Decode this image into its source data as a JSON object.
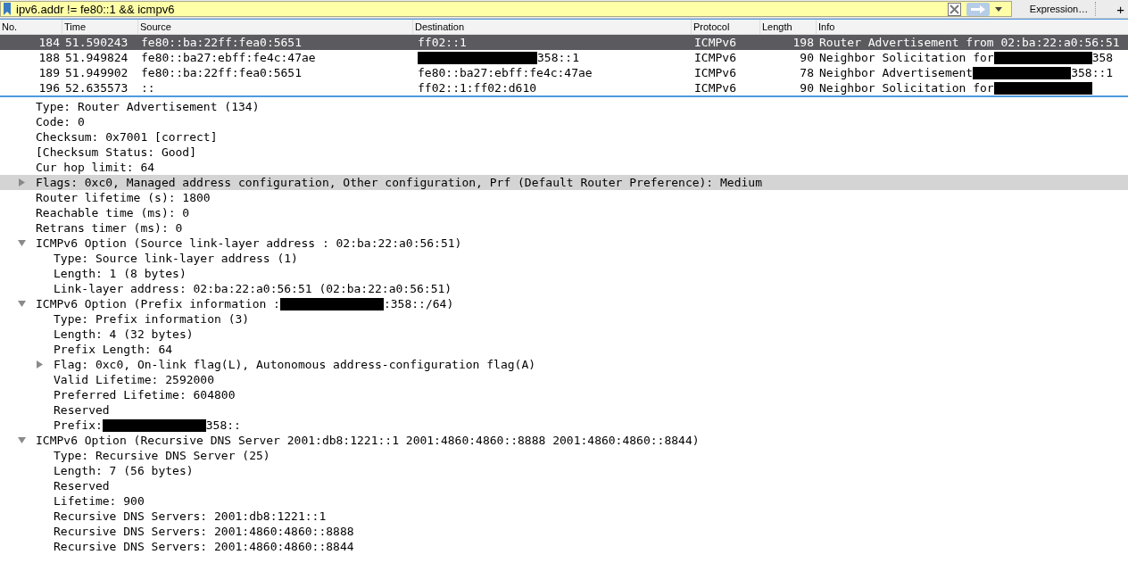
{
  "filter_bar": {
    "value": "ipv6.addr != fe80::1 && icmpv6",
    "expression_button": "Expression…",
    "add_button": "+"
  },
  "packet_list": {
    "columns": [
      "No.",
      "Time",
      "Source",
      "Destination",
      "Protocol",
      "Length",
      "Info"
    ],
    "rows": [
      {
        "selected": true,
        "cells": [
          "184",
          "51.590243",
          "fe80::ba:22ff:fea0:5651",
          "ff02::1",
          "ICMPv6",
          "198",
          "Router Advertisement from 02:ba:22:a0:56:51"
        ]
      },
      {
        "selected": false,
        "cells": [
          "188",
          "51.949824",
          "fe80::ba27:ebff:fe4c:47ae",
          [
            {
              "kind": "redacted"
            },
            {
              "kind": "text",
              "text": "358::1"
            }
          ],
          "ICMPv6",
          "90",
          [
            {
              "kind": "text",
              "text": "Neighbor Solicitation for "
            },
            {
              "kind": "redacted"
            },
            {
              "kind": "text",
              "text": "358"
            }
          ]
        ]
      },
      {
        "selected": false,
        "cells": [
          "189",
          "51.949902",
          "fe80::ba:22ff:fea0:5651",
          "fe80::ba27:ebff:fe4c:47ae",
          "ICMPv6",
          "78",
          [
            {
              "kind": "text",
              "text": "Neighbor Advertisement "
            },
            {
              "kind": "redacted"
            },
            {
              "kind": "text",
              "text": "358::1"
            }
          ]
        ]
      },
      {
        "selected": false,
        "cells": [
          "196",
          "52.635573",
          "::",
          "ff02::1:ff02:d610",
          "ICMPv6",
          "90",
          [
            {
              "kind": "text",
              "text": "Neighbor Solicitation for "
            },
            {
              "kind": "redacted"
            }
          ]
        ]
      }
    ]
  },
  "packet_details": [
    {
      "text": "Type: Router Advertisement (134)",
      "kind": "leaf",
      "selected": false
    },
    {
      "text": "Code: 0",
      "kind": "leaf",
      "selected": false
    },
    {
      "text": "Checksum: 0x7001 [correct]",
      "kind": "leaf",
      "selected": false
    },
    {
      "text": "[Checksum Status: Good]",
      "kind": "leaf",
      "selected": false
    },
    {
      "text": "Cur hop limit: 64",
      "kind": "leaf",
      "selected": false
    },
    {
      "text": "Flags: 0xc0, Managed address configuration, Other configuration, Prf (Default Router Preference): Medium",
      "kind": "branch",
      "expanded": false,
      "selected": true
    },
    {
      "text": "Router lifetime (s): 1800",
      "kind": "leaf",
      "selected": false
    },
    {
      "text": "Reachable time (ms): 0",
      "kind": "leaf",
      "selected": false
    },
    {
      "text": "Retrans timer (ms): 0",
      "kind": "leaf",
      "selected": false
    },
    {
      "text": "ICMPv6 Option (Source link-layer address : 02:ba:22:a0:56:51)",
      "kind": "branch",
      "expanded": true,
      "selected": false,
      "children": [
        {
          "text": "Type: Source link-layer address (1)",
          "kind": "leaf",
          "selected": false
        },
        {
          "text": "Length: 1 (8 bytes)",
          "kind": "leaf",
          "selected": false
        },
        {
          "text": "Link-layer address: 02:ba:22:a0:56:51 (02:ba:22:a0:56:51)",
          "kind": "leaf",
          "selected": false
        }
      ]
    },
    {
      "parts": [
        {
          "kind": "text",
          "text": "ICMPv6 Option (Prefix information :"
        },
        {
          "kind": "redacted"
        },
        {
          "kind": "text",
          "text": ":358::/64)"
        }
      ],
      "kind": "branch",
      "expanded": true,
      "selected": false,
      "children": [
        {
          "text": "Type: Prefix information (3)",
          "kind": "leaf",
          "selected": false
        },
        {
          "text": "Length: 4 (32 bytes)",
          "kind": "leaf",
          "selected": false
        },
        {
          "text": "Prefix Length: 64",
          "kind": "leaf",
          "selected": false
        },
        {
          "text": "Flag: 0xc0, On-link flag(L), Autonomous address-configuration flag(A)",
          "kind": "branch",
          "expanded": false,
          "selected": false
        },
        {
          "text": "Valid Lifetime: 2592000",
          "kind": "leaf",
          "selected": false
        },
        {
          "text": "Preferred Lifetime: 604800",
          "kind": "leaf",
          "selected": false
        },
        {
          "text": "Reserved",
          "kind": "leaf",
          "selected": false
        },
        {
          "parts": [
            {
              "kind": "text",
              "text": "Prefix: "
            },
            {
              "kind": "redacted"
            },
            {
              "kind": "text",
              "text": "358::"
            }
          ],
          "kind": "leaf",
          "selected": false
        }
      ]
    },
    {
      "text": "ICMPv6 Option (Recursive DNS Server 2001:db8:1221::1 2001:4860:4860::8888 2001:4860:4860::8844)",
      "kind": "branch",
      "expanded": true,
      "selected": false,
      "children": [
        {
          "text": "Type: Recursive DNS Server (25)",
          "kind": "leaf",
          "selected": false
        },
        {
          "text": "Length: 7 (56 bytes)",
          "kind": "leaf",
          "selected": false
        },
        {
          "text": "Reserved",
          "kind": "leaf",
          "selected": false
        },
        {
          "text": "Lifetime: 900",
          "kind": "leaf",
          "selected": false
        },
        {
          "text": "Recursive DNS Servers: 2001:db8:1221::1",
          "kind": "leaf",
          "selected": false
        },
        {
          "text": "Recursive DNS Servers: 2001:4860:4860::8888",
          "kind": "leaf",
          "selected": false
        },
        {
          "text": "Recursive DNS Servers: 2001:4860:4860::8844",
          "kind": "leaf",
          "selected": false
        }
      ]
    }
  ]
}
